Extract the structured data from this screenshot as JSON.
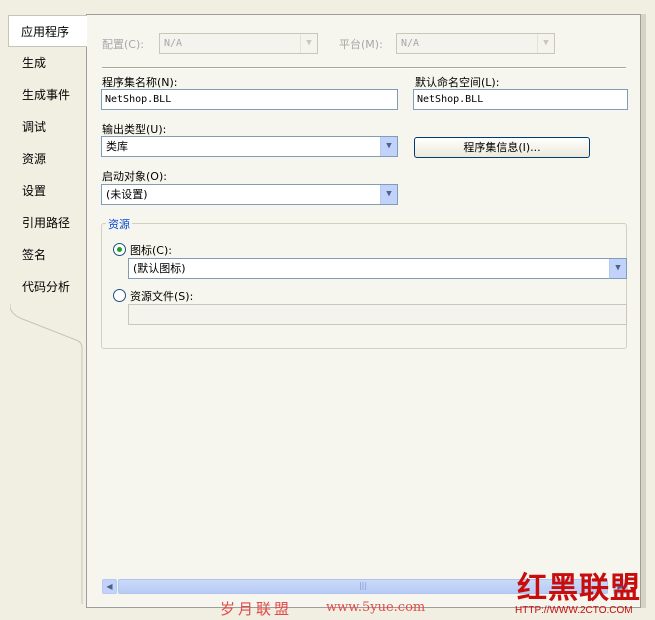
{
  "tabs": [
    {
      "label": "应用程序",
      "active": true
    },
    {
      "label": "生成"
    },
    {
      "label": "生成事件"
    },
    {
      "label": "调试"
    },
    {
      "label": "资源"
    },
    {
      "label": "设置"
    },
    {
      "label": "引用路径"
    },
    {
      "label": "签名"
    },
    {
      "label": "代码分析"
    }
  ],
  "config": {
    "label": "配置(C):",
    "value": "N/A"
  },
  "platform": {
    "label": "平台(M):",
    "value": "N/A"
  },
  "assembly_name": {
    "label": "程序集名称(N):",
    "value": "NetShop.BLL"
  },
  "default_namespace": {
    "label": "默认命名空间(L):",
    "value": "NetShop.BLL"
  },
  "output_type": {
    "label": "输出类型(U):",
    "value": "类库"
  },
  "assembly_info_button": "程序集信息(I)...",
  "startup_object": {
    "label": "启动对象(O):",
    "value": "(未设置)"
  },
  "resources": {
    "title": "资源",
    "icon_option": {
      "label": "图标(C):",
      "selected": true,
      "value": "(默认图标)"
    },
    "resource_file_option": {
      "label": "资源文件(S):",
      "selected": false,
      "value": ""
    }
  },
  "watermark": {
    "center_text": "岁月联盟",
    "center_url": "www.5yue.com",
    "logo_text": "红黑联盟",
    "logo_url": "HTTP://WWW.2CTO.COM"
  }
}
